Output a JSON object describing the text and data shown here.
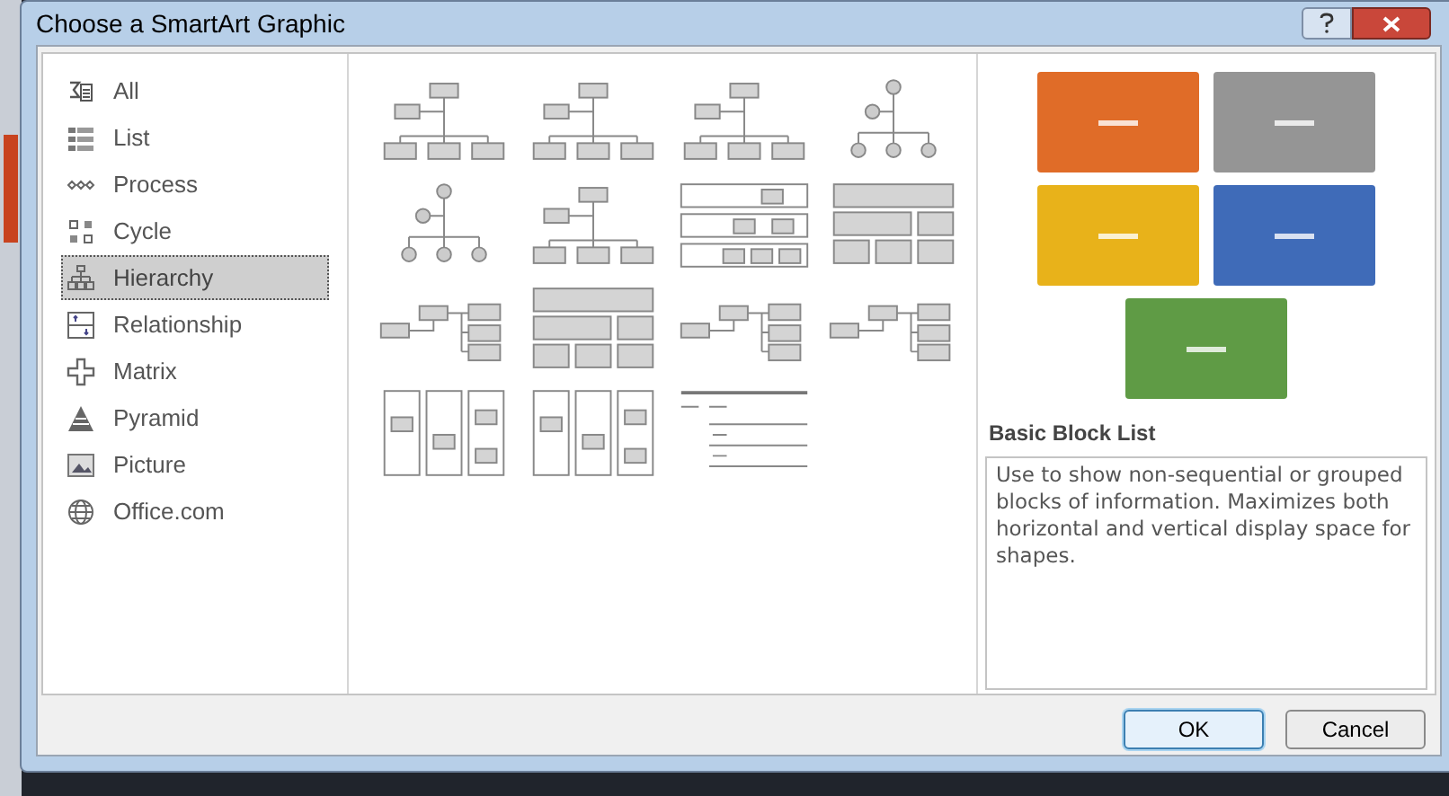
{
  "window": {
    "title": "Choose a SmartArt Graphic"
  },
  "categories": [
    {
      "label": "All",
      "selected": false
    },
    {
      "label": "List",
      "selected": false
    },
    {
      "label": "Process",
      "selected": false
    },
    {
      "label": "Cycle",
      "selected": false
    },
    {
      "label": "Hierarchy",
      "selected": true
    },
    {
      "label": "Relationship",
      "selected": false
    },
    {
      "label": "Matrix",
      "selected": false
    },
    {
      "label": "Pyramid",
      "selected": false
    },
    {
      "label": "Picture",
      "selected": false
    },
    {
      "label": "Office.com",
      "selected": false
    }
  ],
  "layouts": [
    {
      "kind": "org"
    },
    {
      "kind": "org"
    },
    {
      "kind": "org"
    },
    {
      "kind": "circles"
    },
    {
      "kind": "circles"
    },
    {
      "kind": "org"
    },
    {
      "kind": "bands"
    },
    {
      "kind": "blocks"
    },
    {
      "kind": "horizontal"
    },
    {
      "kind": "blocks"
    },
    {
      "kind": "horizontal"
    },
    {
      "kind": "horizontal"
    },
    {
      "kind": "columns"
    },
    {
      "kind": "columns"
    },
    {
      "kind": "lines"
    }
  ],
  "preview": {
    "blocks": [
      {
        "color": "#e06c28"
      },
      {
        "color": "#959595"
      },
      {
        "color": "#e8b21a"
      },
      {
        "color": "#3f6bb8"
      },
      {
        "color": "#5f9b45"
      }
    ],
    "title": "Basic Block List",
    "description": "Use to show non-sequential or grouped blocks of information. Maximizes both horizontal and vertical display space for shapes."
  },
  "buttons": [
    {
      "label": "OK",
      "default": true
    },
    {
      "label": "Cancel",
      "default": false
    }
  ]
}
